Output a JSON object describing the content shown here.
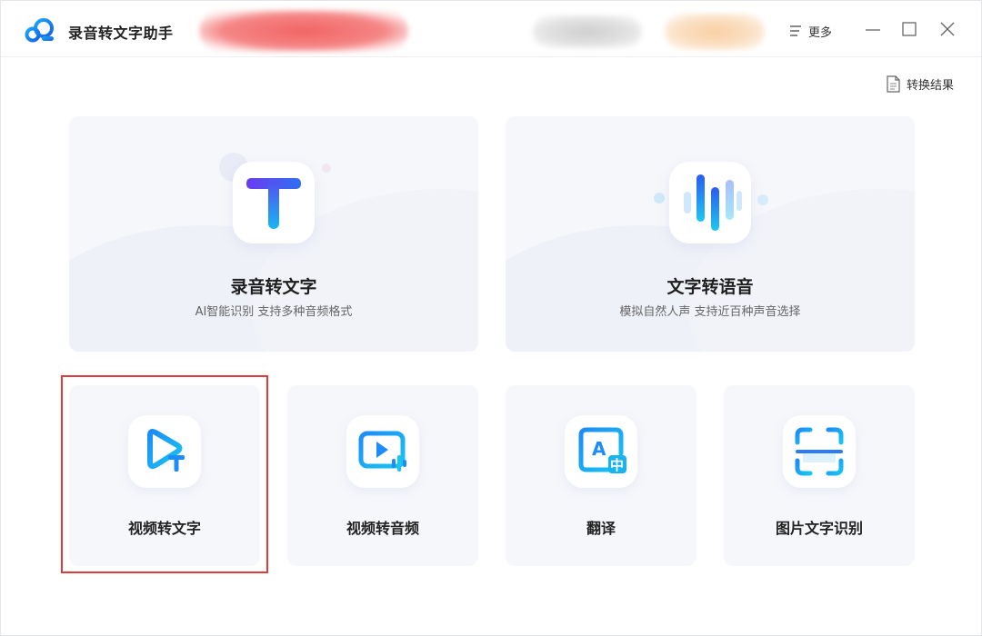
{
  "app": {
    "title": "录音转文字助手",
    "logo_icon": "cloud-logo-icon"
  },
  "header": {
    "more_label": "更多",
    "more_icon": "menu-lines-icon",
    "window_controls": [
      "minimize-icon",
      "maximize-icon",
      "close-icon"
    ]
  },
  "toolbar": {
    "result_label": "转换结果",
    "result_icon": "document-icon"
  },
  "features_big": [
    {
      "title": "录音转文字",
      "subtitle": "AI智能识别 支持多种音频格式",
      "icon": "text-t-icon"
    },
    {
      "title": "文字转语音",
      "subtitle": "模拟自然人声 支持近百种声音选择",
      "icon": "sound-wave-icon"
    }
  ],
  "features_small": [
    {
      "title": "视频转文字",
      "icon": "video-to-text-icon"
    },
    {
      "title": "视频转音频",
      "icon": "video-to-audio-icon"
    },
    {
      "title": "翻译",
      "icon": "translate-icon"
    },
    {
      "title": "图片文字识别",
      "icon": "scan-ocr-icon"
    }
  ],
  "colors": {
    "accent_blue": "#1d8cf8",
    "accent_purple": "#6a3cf0",
    "accent_cyan": "#18c6f0",
    "card_bg": "#f6f7fb",
    "highlight": "#e03a3a"
  }
}
